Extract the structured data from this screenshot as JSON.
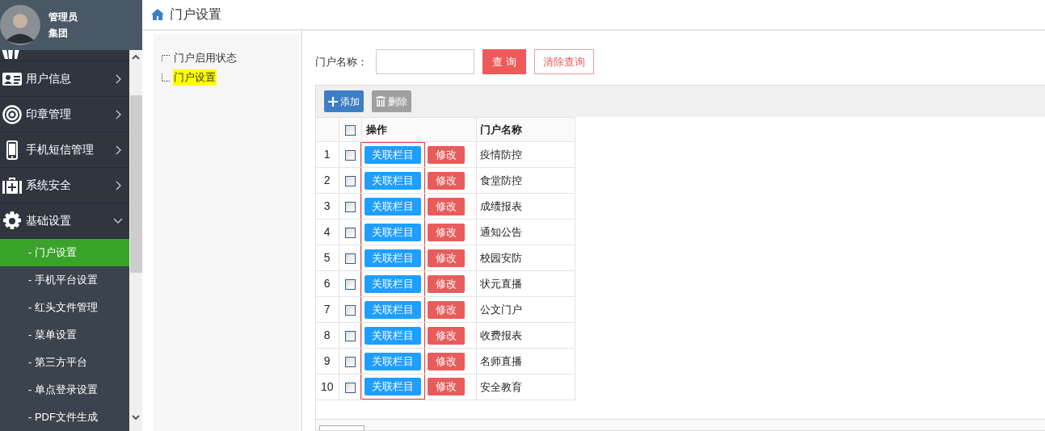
{
  "user": {
    "role": "管理员",
    "org": "集团"
  },
  "menu": [
    {
      "label": "用户信息",
      "expanded": false
    },
    {
      "label": "印章管理",
      "expanded": false
    },
    {
      "label": "手机短信管理",
      "expanded": false
    },
    {
      "label": "系统安全",
      "expanded": false
    },
    {
      "label": "基础设置",
      "expanded": true,
      "children": [
        {
          "label": "- 门户设置",
          "selected": true
        },
        {
          "label": "- 手机平台设置",
          "selected": false
        },
        {
          "label": "- 红头文件管理",
          "selected": false
        },
        {
          "label": "- 菜单设置",
          "selected": false
        },
        {
          "label": "- 第三方平台",
          "selected": false
        },
        {
          "label": "- 单点登录设置",
          "selected": false
        },
        {
          "label": "- PDF文件生成",
          "selected": false
        }
      ]
    }
  ],
  "breadcrumb": "门户设置",
  "tree": [
    {
      "label": "门户启用状态",
      "selected": false
    },
    {
      "label": "门户设置",
      "selected": true
    }
  ],
  "search": {
    "label": "门户名称：",
    "query_button": "查 询",
    "clear_button": "清除查询"
  },
  "toolbar": [
    {
      "label": "添加",
      "kind": "add"
    },
    {
      "label": "删除",
      "kind": "delete"
    }
  ],
  "table": {
    "columns": [
      "操作",
      "门户名称"
    ],
    "header_checked": false,
    "rows": [
      {
        "index": "1",
        "checked": false,
        "link": "关联栏目",
        "edit": "修改",
        "name": "疫情防控"
      },
      {
        "index": "2",
        "checked": false,
        "link": "关联栏目",
        "edit": "修改",
        "name": "食堂防控"
      },
      {
        "index": "3",
        "checked": false,
        "link": "关联栏目",
        "edit": "修改",
        "name": "成绩报表"
      },
      {
        "index": "4",
        "checked": false,
        "link": "关联栏目",
        "edit": "修改",
        "name": "通知公告"
      },
      {
        "index": "5",
        "checked": false,
        "link": "关联栏目",
        "edit": "修改",
        "name": "校园安防"
      },
      {
        "index": "6",
        "checked": false,
        "link": "关联栏目",
        "edit": "修改",
        "name": "状元直播"
      },
      {
        "index": "7",
        "checked": false,
        "link": "关联栏目",
        "edit": "修改",
        "name": "公文门户"
      },
      {
        "index": "8",
        "checked": false,
        "link": "关联栏目",
        "edit": "修改",
        "name": "收费报表"
      },
      {
        "index": "9",
        "checked": false,
        "link": "关联栏目",
        "edit": "修改",
        "name": "名师直播"
      },
      {
        "index": "10",
        "checked": false,
        "link": "关联栏目",
        "edit": "修改",
        "name": "安全教育"
      }
    ]
  }
}
